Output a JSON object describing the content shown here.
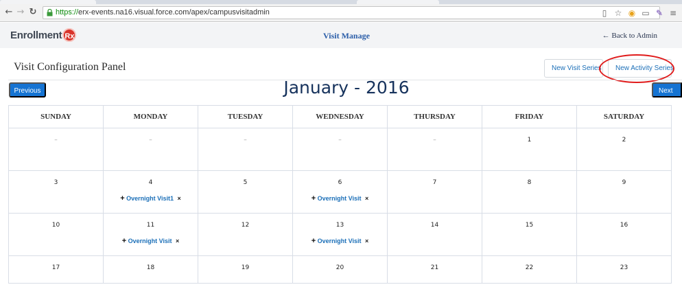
{
  "browser": {
    "url_scheme": "https://",
    "url_rest": "erx-events.na16.visual.force.com/apex/campusvisitadmin"
  },
  "header": {
    "logo_text": "Enrollment",
    "logo_badge": "Rx",
    "title": "Visit Manage",
    "back_link": "← Back to Admin"
  },
  "panel": {
    "title": "Visit Configuration Panel",
    "new_visit_series": "New Visit Series",
    "new_activity_series": "New Activity Series"
  },
  "nav": {
    "previous": "Previous",
    "next": "Next",
    "month_title": "January - 2016"
  },
  "calendar": {
    "weekdays": [
      "SUNDAY",
      "MONDAY",
      "TUESDAY",
      "WEDNESDAY",
      "THURSDAY",
      "FRIDAY",
      "SATURDAY"
    ],
    "weeks": [
      [
        {
          "day": "–",
          "events": []
        },
        {
          "day": "–",
          "events": []
        },
        {
          "day": "–",
          "events": []
        },
        {
          "day": "–",
          "events": []
        },
        {
          "day": "–",
          "events": []
        },
        {
          "day": "1",
          "events": []
        },
        {
          "day": "2",
          "events": []
        }
      ],
      [
        {
          "day": "3",
          "events": []
        },
        {
          "day": "4",
          "events": [
            "Overnight Visit1"
          ]
        },
        {
          "day": "5",
          "events": []
        },
        {
          "day": "6",
          "events": [
            "Overnight Visit"
          ]
        },
        {
          "day": "7",
          "events": []
        },
        {
          "day": "8",
          "events": []
        },
        {
          "day": "9",
          "events": []
        }
      ],
      [
        {
          "day": "10",
          "events": []
        },
        {
          "day": "11",
          "events": [
            "Overnight Visit"
          ]
        },
        {
          "day": "12",
          "events": []
        },
        {
          "day": "13",
          "events": [
            "Overnight Visit"
          ]
        },
        {
          "day": "14",
          "events": []
        },
        {
          "day": "15",
          "events": []
        },
        {
          "day": "16",
          "events": []
        }
      ],
      [
        {
          "day": "17",
          "events": []
        },
        {
          "day": "18",
          "events": []
        },
        {
          "day": "19",
          "events": []
        },
        {
          "day": "20",
          "events": []
        },
        {
          "day": "21",
          "events": []
        },
        {
          "day": "22",
          "events": []
        },
        {
          "day": "23",
          "events": []
        }
      ]
    ]
  },
  "colors": {
    "primary_blue": "#1573d2",
    "link_blue": "#1b6fb8",
    "annotation_red": "#e01b1b",
    "month_title": "#16325c"
  },
  "icons": {
    "back": "back-arrow-icon",
    "forward": "forward-arrow-icon",
    "reload": "reload-icon",
    "lock": "lock-icon",
    "add_event": "plus-icon",
    "remove_event": "close-icon"
  }
}
